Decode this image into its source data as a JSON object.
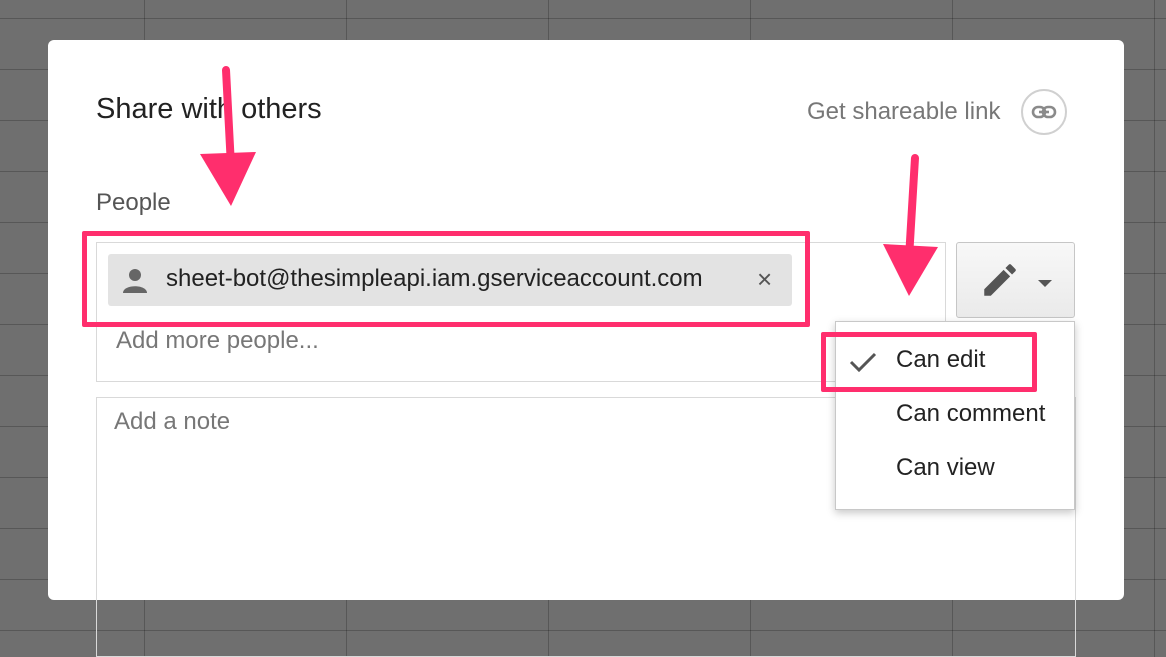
{
  "dialog": {
    "title": "Share with others",
    "shareable_link_label": "Get shareable link",
    "people_label": "People",
    "chip": {
      "email": "sheet-bot@thesimpleapi.iam.gserviceaccount.com",
      "remove_glyph": "×"
    },
    "add_people_placeholder": "Add more people...",
    "note_placeholder": "Add a note"
  },
  "permission_menu": {
    "current_icon": "pencil-icon",
    "items": [
      {
        "label": "Can edit",
        "checked": true
      },
      {
        "label": "Can comment",
        "checked": false
      },
      {
        "label": "Can view",
        "checked": false
      }
    ]
  },
  "annotations": {
    "color": "#ff2e6d"
  },
  "colors": {
    "backdrop": "#6f6f6f",
    "dialog_bg": "#ffffff",
    "chip_bg": "#e3e3e3",
    "annotation": "#ff2e6d"
  }
}
